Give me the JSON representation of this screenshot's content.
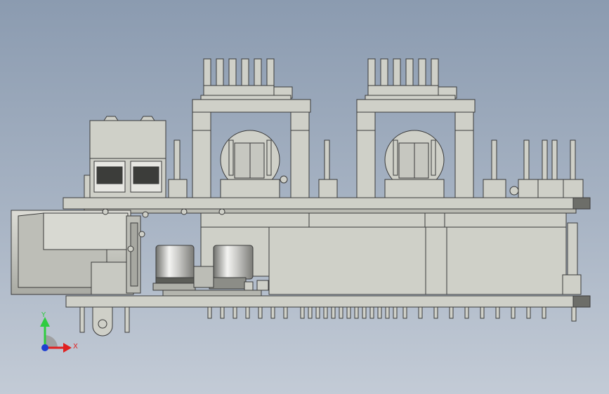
{
  "viewport": {
    "background_top": "#8b9bb0",
    "background_bottom": "#c3cbd6",
    "part_fill": "#cfd0c8",
    "part_fill_dark": "#b9bab2",
    "edge_color": "#3a3a3a"
  },
  "triad": {
    "y_label": "Y",
    "x_label": "X",
    "y_color": "#2ecc40",
    "x_color": "#e02020",
    "z_color": "#1f3fd1"
  }
}
